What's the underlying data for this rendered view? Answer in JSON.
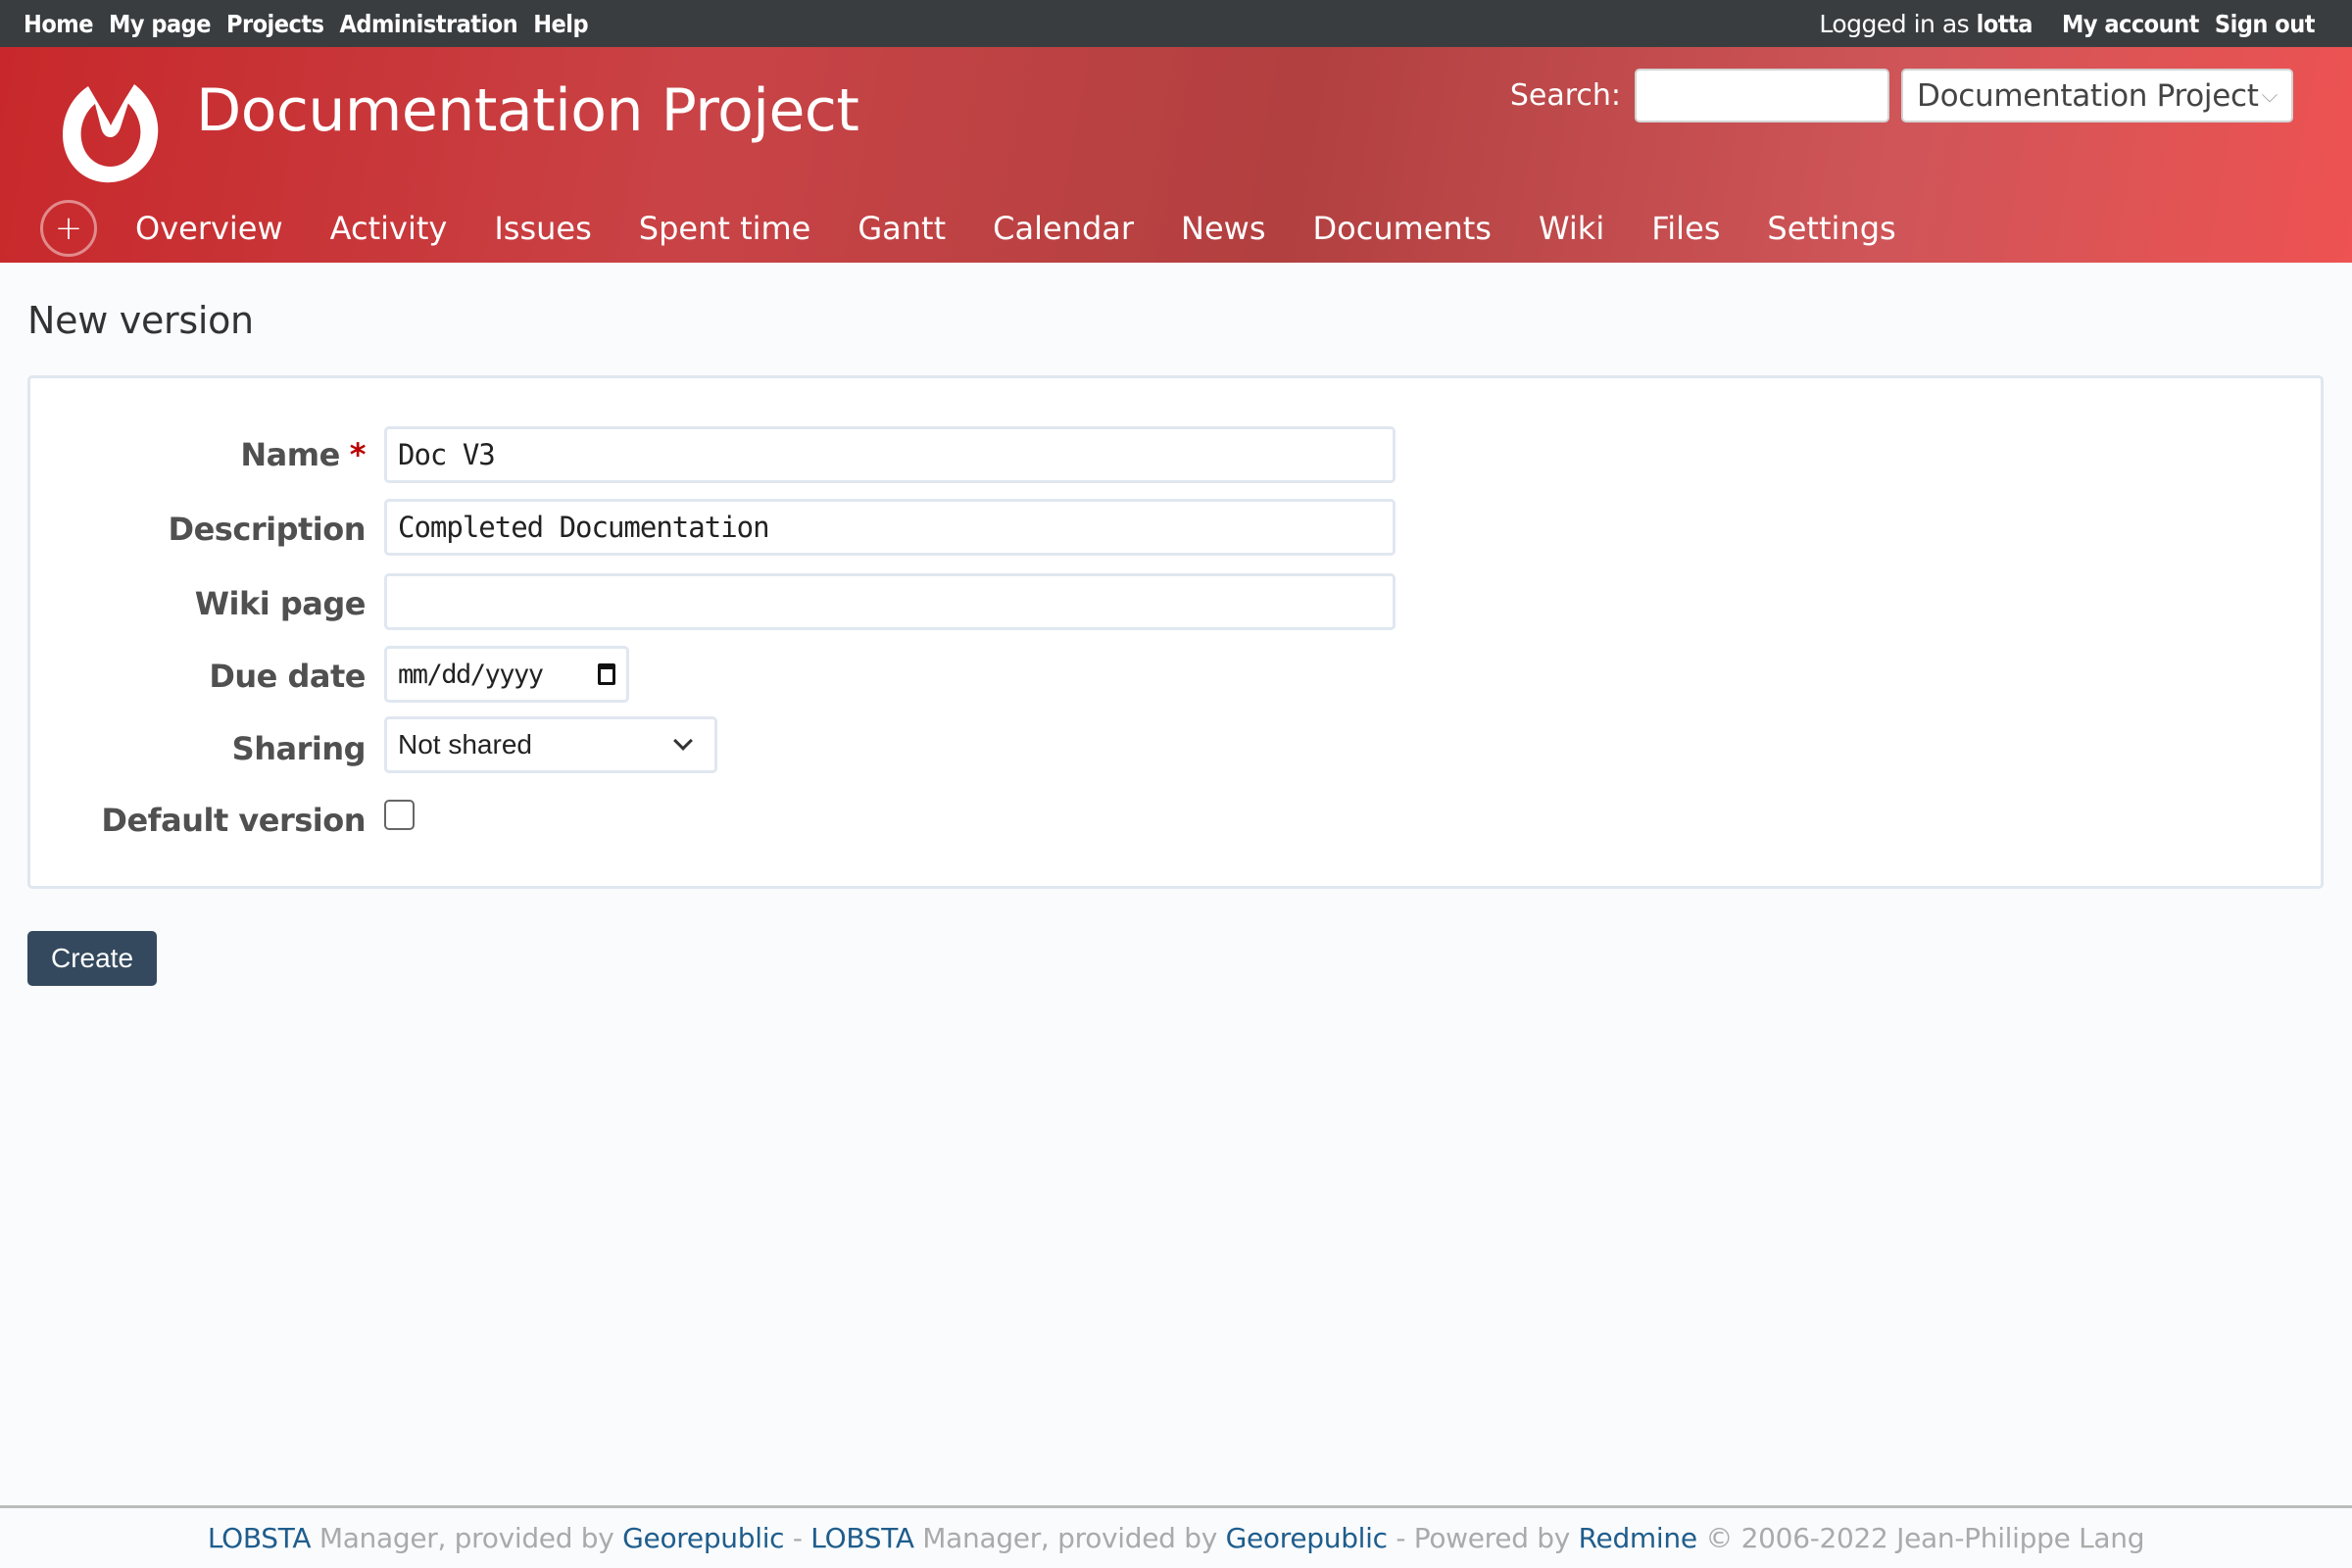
{
  "top_menu": {
    "left_links": [
      "Home",
      "My page",
      "Projects",
      "Administration",
      "Help"
    ],
    "logged_in_prefix": "Logged in as",
    "username": "lotta",
    "my_account": "My account",
    "sign_out": "Sign out"
  },
  "header": {
    "project_title": "Documentation Project",
    "search_label": "Search:",
    "search_value": "",
    "project_jump": "Documentation Project",
    "brand_color": "#c8282b"
  },
  "main_menu": {
    "new_object_icon": "+",
    "tabs": [
      "Overview",
      "Activity",
      "Issues",
      "Spent time",
      "Gantt",
      "Calendar",
      "News",
      "Documents",
      "Wiki",
      "Files",
      "Settings"
    ]
  },
  "page": {
    "title": "New version"
  },
  "form": {
    "name": {
      "label": "Name",
      "required_mark": "*",
      "value": "Doc V3"
    },
    "description": {
      "label": "Description",
      "value": "Completed Documentation"
    },
    "wiki_page": {
      "label": "Wiki page",
      "value": ""
    },
    "due_date": {
      "label": "Due date",
      "placeholder": "mm/dd/yyyy"
    },
    "sharing": {
      "label": "Sharing",
      "selected": "Not shared"
    },
    "default_version": {
      "label": "Default version",
      "checked": false
    }
  },
  "actions": {
    "create_label": "Create",
    "create_color": "#34495e"
  },
  "footer": {
    "parts": [
      {
        "text": "LOBSTA",
        "link": true
      },
      {
        "text": " Manager, provided by ",
        "link": false
      },
      {
        "text": "Georepublic",
        "link": true
      },
      {
        "text": " - ",
        "link": false
      },
      {
        "text": "LOBSTA",
        "link": true
      },
      {
        "text": " Manager, provided by ",
        "link": false
      },
      {
        "text": "Georepublic",
        "link": true
      },
      {
        "text": " - Powered by ",
        "link": false
      },
      {
        "text": "Redmine",
        "link": true
      },
      {
        "text": " © 2006-2022 Jean-Philippe Lang",
        "link": false
      }
    ]
  }
}
